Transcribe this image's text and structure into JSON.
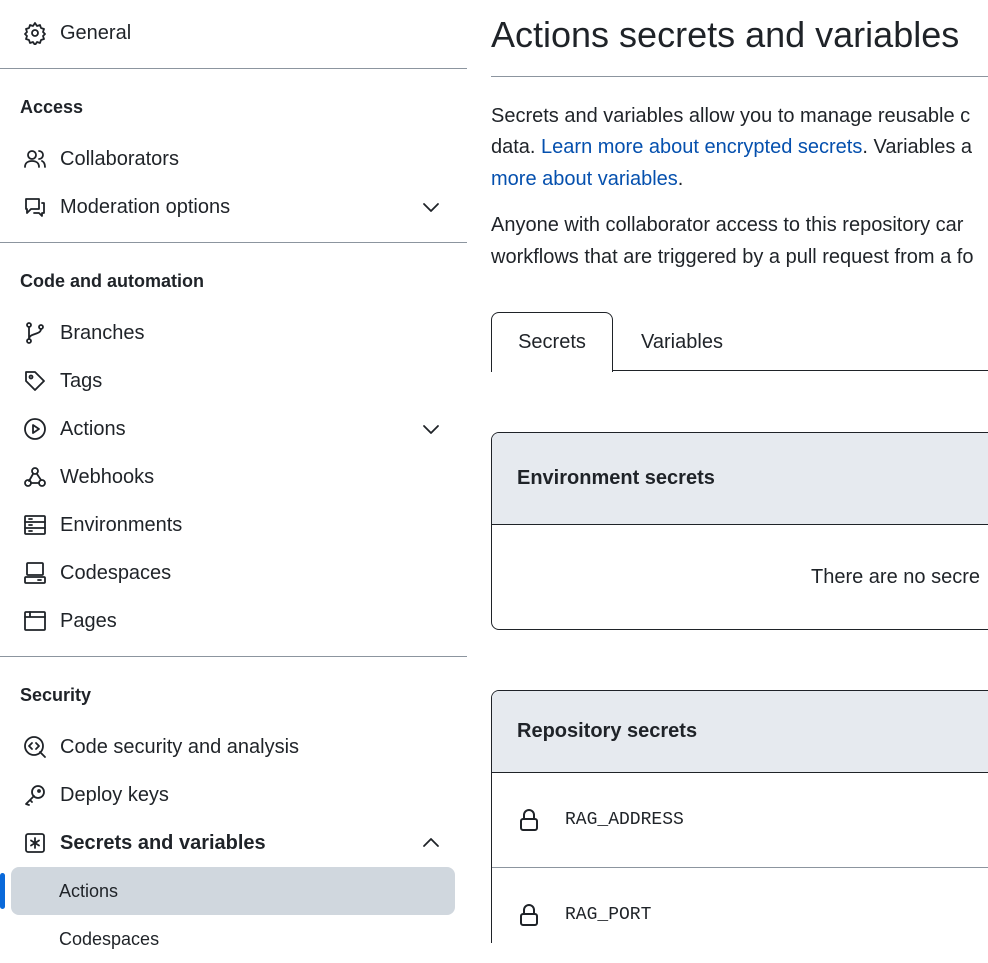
{
  "sidebar": {
    "general": "General",
    "sections": [
      {
        "heading": "Access",
        "items": [
          "Collaborators",
          "Moderation options"
        ]
      },
      {
        "heading": "Code and automation",
        "items": [
          "Branches",
          "Tags",
          "Actions",
          "Webhooks",
          "Environments",
          "Codespaces",
          "Pages"
        ]
      },
      {
        "heading": "Security",
        "items": [
          "Code security and analysis",
          "Deploy keys",
          "Secrets and variables"
        ],
        "subitems": [
          "Actions",
          "Codespaces"
        ]
      }
    ]
  },
  "main": {
    "title": "Actions secrets and variables",
    "p1": {
      "l1": "Secrets and variables allow you to manage reusable c",
      "l2a": "data. ",
      "link1": "Learn more about encrypted secrets",
      "l2b": ". Variables a",
      "link2": "more about variables",
      "l3b": "."
    },
    "p2": {
      "l1": "Anyone with collaborator access to this repository car",
      "l2": "workflows that are triggered by a pull request from a fo"
    },
    "tabs": [
      "Secrets",
      "Variables"
    ],
    "env": {
      "title": "Environment secrets",
      "empty": "There are no secre"
    },
    "repo": {
      "title": "Repository secrets",
      "secrets": [
        "RAG_ADDRESS",
        "RAG_PORT"
      ]
    }
  },
  "colors": {
    "accent": "#0969da",
    "link": "#0550ae",
    "active_bg": "#d0d7de",
    "box_header": "#e6eaef"
  }
}
